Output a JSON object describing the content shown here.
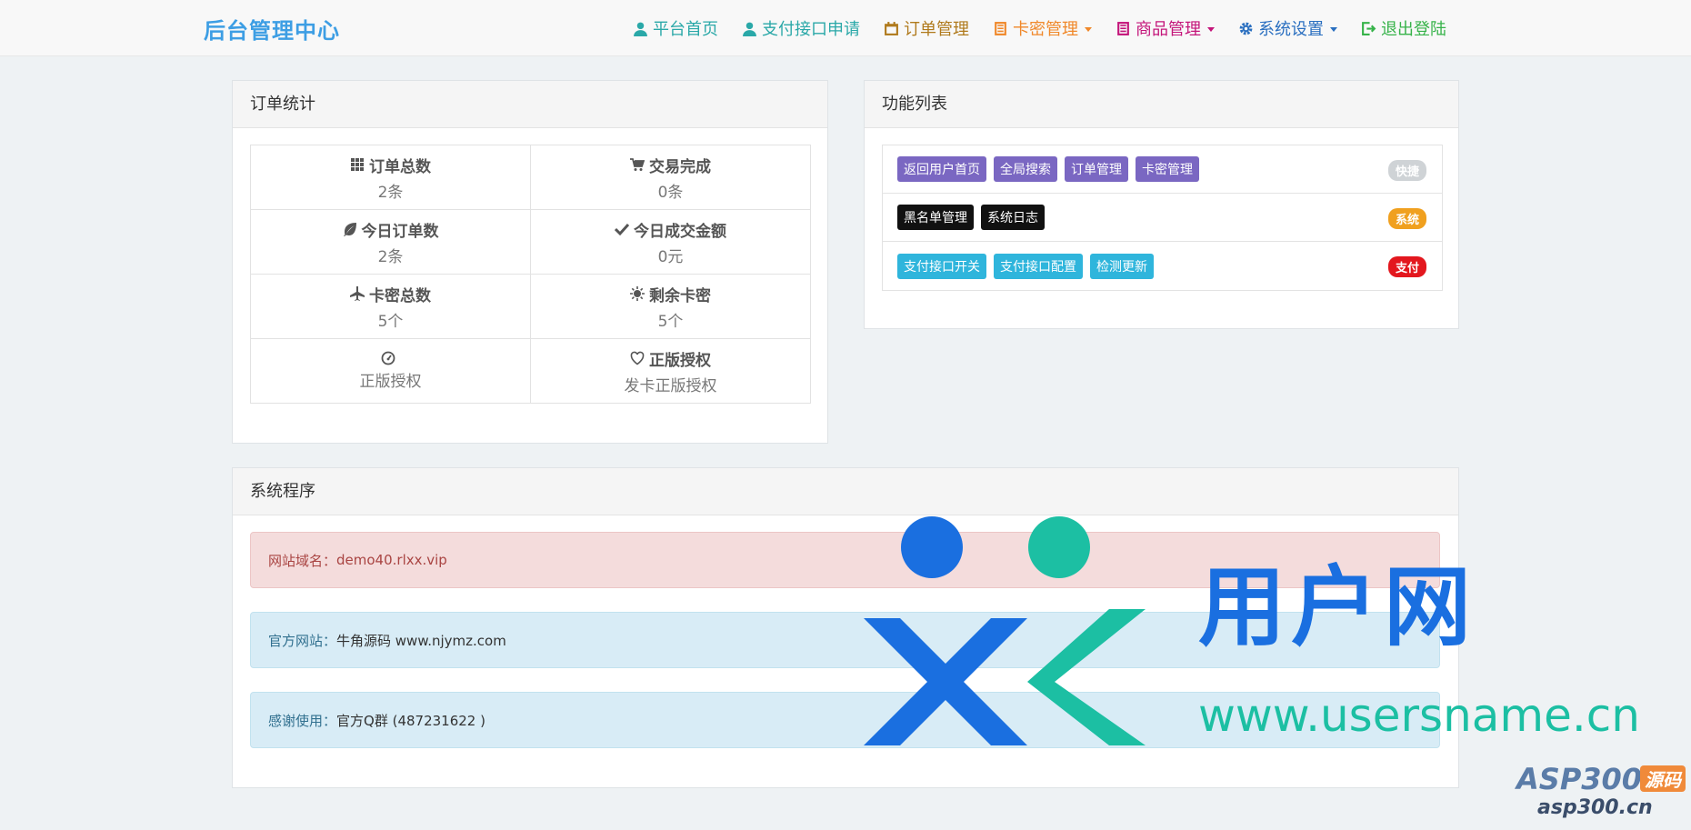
{
  "brand": "后台管理中心",
  "nav": [
    {
      "label": "平台首页",
      "icon": "user-icon",
      "color": "#2aa8a8"
    },
    {
      "label": "支付接口申请",
      "icon": "user-icon",
      "color": "#2aa8a8"
    },
    {
      "label": "订单管理",
      "icon": "calendar-icon",
      "color": "#b07a1c"
    },
    {
      "label": "卡密管理",
      "icon": "list-icon",
      "color": "#f0882a"
    },
    {
      "label": "商品管理",
      "icon": "list-icon",
      "color": "#c4157a"
    },
    {
      "label": "系统设置",
      "icon": "gear-icon",
      "color": "#2a6fc0"
    },
    {
      "label": "退出登陆",
      "icon": "logout-icon",
      "color": "#37b34a"
    }
  ],
  "orders": {
    "title": "订单统计",
    "stats": [
      {
        "label": "订单总数",
        "value": "2条",
        "icon": "grid-icon"
      },
      {
        "label": "交易完成",
        "value": "0条",
        "icon": "cart-icon"
      },
      {
        "label": "今日订单数",
        "value": "2条",
        "icon": "leaf-icon"
      },
      {
        "label": "今日成交金额",
        "value": "0元",
        "icon": "check-icon"
      },
      {
        "label": "卡密总数",
        "value": "5个",
        "icon": "plane-icon"
      },
      {
        "label": "剩余卡密",
        "value": "5个",
        "icon": "sun-icon"
      },
      {
        "label": "",
        "value": "正版授权",
        "icon": "dashboard-icon"
      },
      {
        "label": "正版授权",
        "value": "发卡正版授权",
        "icon": "heart-icon"
      }
    ]
  },
  "funcs": {
    "title": "功能列表",
    "rows": [
      {
        "tags": [
          "返回用户首页",
          "全局搜索",
          "订单管理",
          "卡密管理"
        ],
        "badge": "快捷"
      },
      {
        "tags": [
          "黑名单管理",
          "系统日志"
        ],
        "badge": "系统"
      },
      {
        "tags": [
          "支付接口开关",
          "支付接口配置",
          "检测更新"
        ],
        "badge": "支付"
      }
    ]
  },
  "sys": {
    "title": "系统程序",
    "domain_label": "网站域名：",
    "domain_value": "demo40.rlxx.vip",
    "site_label": "官方网站：",
    "site_value": "牛角源码 www.njymz.com",
    "thanks_label": "感谢使用：",
    "thanks_value": "官方Q群 (487231622 )"
  },
  "watermark": {
    "cn": "用户网",
    "url": "www.usersname.cn",
    "asp": "ASP300",
    "asp_badge": "源码",
    "asp_url": "asp300.cn"
  }
}
